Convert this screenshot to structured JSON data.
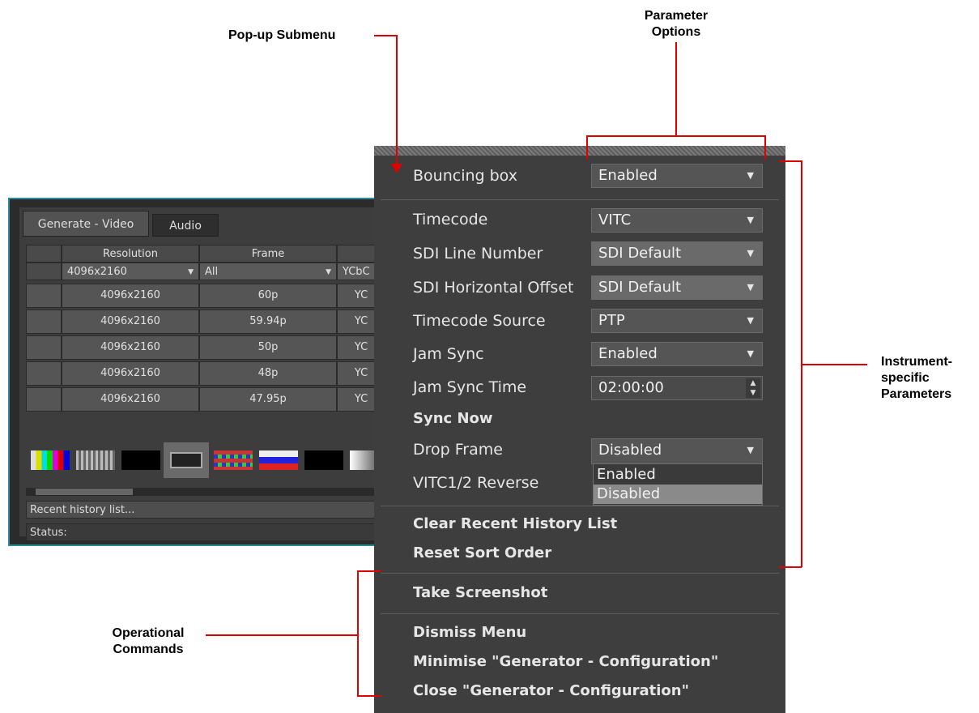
{
  "callouts": {
    "popup_submenu": "Pop-up Submenu",
    "parameter_options_line1": "Parameter",
    "parameter_options_line2": "Options",
    "instrument_line1": "Instrument-",
    "instrument_line2": "specific",
    "instrument_line3": "Parameters",
    "operational_line1": "Operational",
    "operational_line2": "Commands"
  },
  "generator": {
    "tabs": [
      "Generate - Video",
      "Audio"
    ],
    "columns": [
      "Resolution",
      "Frame",
      ""
    ],
    "filters": {
      "resolution": "4096x2160",
      "frame": "All",
      "third": "YCbC"
    },
    "rows": [
      {
        "resolution": "4096x2160",
        "frame": "60p",
        "third": "YC"
      },
      {
        "resolution": "4096x2160",
        "frame": "59.94p",
        "third": "YC"
      },
      {
        "resolution": "4096x2160",
        "frame": "50p",
        "third": "YC"
      },
      {
        "resolution": "4096x2160",
        "frame": "48p",
        "third": "YC"
      },
      {
        "resolution": "4096x2160",
        "frame": "47.95p",
        "third": "YC"
      }
    ],
    "recent_history": "Recent history list...",
    "status": "Status:"
  },
  "menu": {
    "bouncing_box": {
      "label": "Bouncing box",
      "value": "Enabled"
    },
    "timecode": {
      "label": "Timecode",
      "value": "VITC"
    },
    "sdi_line": {
      "label": "SDI Line Number",
      "value": "SDI Default"
    },
    "sdi_offset": {
      "label": "SDI Horizontal Offset",
      "value": "SDI Default"
    },
    "timecode_source": {
      "label": "Timecode Source",
      "value": "PTP"
    },
    "jam_sync": {
      "label": "Jam Sync",
      "value": "Enabled"
    },
    "jam_sync_time": {
      "label": "Jam Sync Time",
      "value": "02:00:00"
    },
    "sync_now": "Sync Now",
    "drop_frame": {
      "label": "Drop Frame",
      "value": "Disabled"
    },
    "drop_options": [
      "Enabled",
      "Disabled"
    ],
    "vitc_reverse": "VITC1/2 Reverse",
    "clear_history": "Clear Recent History List",
    "reset_sort": "Reset Sort Order",
    "take_screenshot": "Take Screenshot",
    "dismiss": "Dismiss Menu",
    "minimise": "Minimise \"Generator - Configuration\"",
    "close": "Close \"Generator - Configuration\""
  },
  "colors": {
    "annotation": "#e10000",
    "window_border": "#2a8a98",
    "menu_bg": "#3e3e3e"
  }
}
